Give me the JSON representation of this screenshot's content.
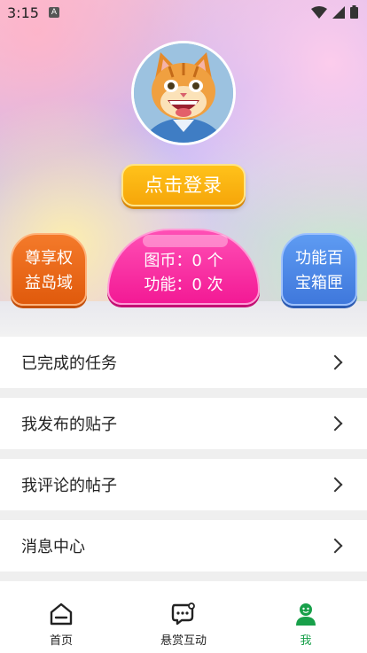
{
  "status": {
    "time": "3:15",
    "notif": "A"
  },
  "header": {
    "login_label": "点击登录",
    "left_pill": {
      "line1": "尊享权",
      "line2": "益岛域"
    },
    "center": {
      "line1": "图币：0 个",
      "line2": "功能：0 次"
    },
    "right_pill": {
      "line1": "功能百",
      "line2": "宝箱匣"
    }
  },
  "menu": [
    {
      "label": "已完成的任务"
    },
    {
      "label": "我发布的贴子"
    },
    {
      "label": "我评论的帖子"
    },
    {
      "label": "消息中心"
    }
  ],
  "tabbar": [
    {
      "label": "首页",
      "icon": "home-icon",
      "active": false
    },
    {
      "label": "悬赏互动",
      "icon": "chat-icon",
      "active": false
    },
    {
      "label": "我",
      "icon": "user-icon",
      "active": true
    }
  ],
  "colors": {
    "accent": "#18a04a",
    "login": "#f6a60a",
    "center": "#f31a95",
    "left": "#e05a0c",
    "right": "#3f78dc"
  }
}
